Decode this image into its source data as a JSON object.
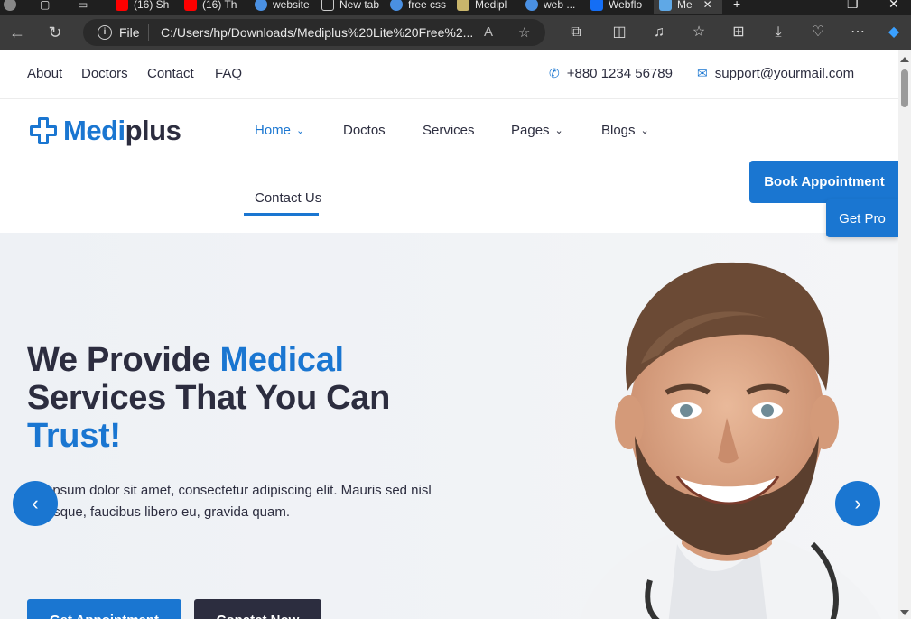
{
  "browser": {
    "tabs": [
      {
        "label": "(16) Sh",
        "color": "#ff0000"
      },
      {
        "label": "(16) Th",
        "color": "#ff0000"
      },
      {
        "label": "website",
        "color": "#4a90e2"
      },
      {
        "label": "New tab",
        "color": "#cccccc"
      },
      {
        "label": "free css",
        "color": "#4a90e2"
      },
      {
        "label": "Medipl",
        "color": "#c9b56b"
      },
      {
        "label": "web ...",
        "color": "#4a90e2"
      },
      {
        "label": "Webflo",
        "color": "#146ef5"
      },
      {
        "label": "Me",
        "color": "#5fa8e6"
      }
    ],
    "file_label": "File",
    "url": "C:/Users/hp/Downloads/Mediplus%20Lite%20Free%2...",
    "colors": {
      "tabbar": "#1f1f1f",
      "toolbar": "#3b3b3b"
    }
  },
  "topbar": {
    "links": [
      "About",
      "Doctors",
      "Contact",
      "FAQ"
    ],
    "phone": "+880 1234 56789",
    "email": "support@yourmail.com"
  },
  "header": {
    "logo_part1": "Medi",
    "logo_part2": "plus",
    "nav": {
      "home": "Home",
      "doctors": "Doctos",
      "services": "Services",
      "pages": "Pages",
      "blogs": "Blogs",
      "contact": "Contact Us"
    },
    "book_button": "Book Appointment",
    "get_pro": "Get Pro"
  },
  "hero": {
    "title_part1": "We Provide ",
    "title_highlight1": "Medical",
    "title_part2": " Services That You Can ",
    "title_highlight2": "Trust!",
    "line1": "em ipsum dolor sit amet, consectetur adipiscing elit. Mauris sed nisl",
    "line2": "entesque, faucibus libero eu, gravida quam.",
    "primary_button": "Get Appointment",
    "secondary_button": "Conatct Now"
  },
  "colors": {
    "accent": "#1a76d1",
    "dark": "#2c2d3f"
  }
}
